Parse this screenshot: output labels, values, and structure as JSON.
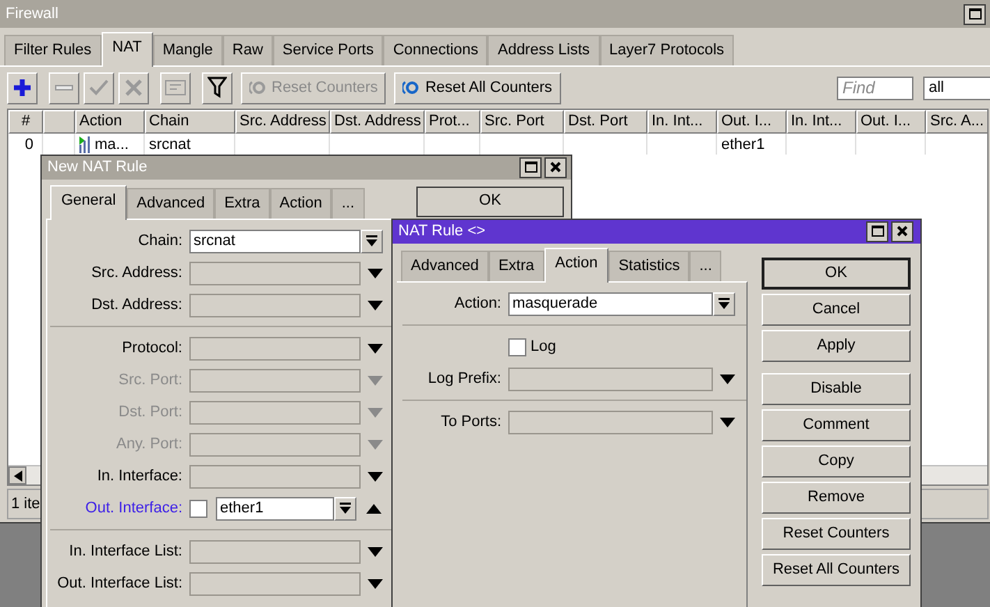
{
  "firewall": {
    "title": "Firewall",
    "tabs": [
      {
        "label": "Filter Rules",
        "selected": false
      },
      {
        "label": "NAT",
        "selected": true
      },
      {
        "label": "Mangle",
        "selected": false
      },
      {
        "label": "Raw",
        "selected": false
      },
      {
        "label": "Service Ports",
        "selected": false
      },
      {
        "label": "Connections",
        "selected": false
      },
      {
        "label": "Address Lists",
        "selected": false
      },
      {
        "label": "Layer7 Protocols",
        "selected": false
      }
    ],
    "toolbar": {
      "icon_buttons": [
        {
          "kind": "add",
          "disabled": false
        },
        {
          "kind": "remove",
          "disabled": true
        },
        {
          "kind": "enable",
          "disabled": true
        },
        {
          "kind": "disable",
          "disabled": true
        },
        {
          "kind": "comment",
          "disabled": true
        },
        {
          "kind": "filter",
          "disabled": false
        }
      ],
      "text_buttons": [
        {
          "label": "Reset Counters",
          "disabled": true
        },
        {
          "label": "Reset All Counters",
          "disabled": false
        }
      ],
      "find": {
        "placeholder": "Find"
      },
      "filter_select": {
        "value": "all"
      }
    },
    "table": {
      "columns": [
        "#",
        null,
        "Action",
        "Chain",
        "Src. Address",
        "Dst. Address",
        "Prot...",
        "Src. Port",
        "Dst. Port",
        "In. Int...",
        "Out. I...",
        "In. Int...",
        "Out. I...",
        "Src. A..."
      ],
      "rows": [
        {
          "cells": [
            "0",
            null,
            "ma...",
            "srcnat",
            null,
            null,
            null,
            null,
            null,
            null,
            "ether1",
            null,
            null,
            null
          ]
        }
      ]
    },
    "status": "1 ite"
  },
  "new_nat_rule": {
    "title": "New NAT Rule",
    "tabs": [
      {
        "label": "General",
        "selected": true
      },
      {
        "label": "Advanced",
        "selected": false
      },
      {
        "label": "Extra",
        "selected": false
      },
      {
        "label": "Action",
        "selected": false
      },
      {
        "label": "...",
        "selected": false
      }
    ],
    "ok_button": "OK",
    "groups": [
      [
        {
          "kind": "select",
          "label": "Chain:",
          "value": "srcnat"
        },
        {
          "kind": "combo",
          "label": "Src. Address:",
          "disabled": false
        },
        {
          "kind": "combo",
          "label": "Dst. Address:",
          "disabled": false
        }
      ],
      [
        {
          "kind": "combo",
          "label": "Protocol:",
          "disabled": false
        },
        {
          "kind": "combo",
          "label": "Src. Port:",
          "disabled": true
        },
        {
          "kind": "combo",
          "label": "Dst. Port:",
          "disabled": true
        },
        {
          "kind": "combo",
          "label": "Any. Port:",
          "disabled": true
        },
        {
          "kind": "combo",
          "label": "In. Interface:",
          "disabled": false
        },
        {
          "kind": "interface",
          "label": "Out. Interface:",
          "value": "ether1",
          "checked": false
        }
      ],
      [
        {
          "kind": "combo",
          "label": "In. Interface List:",
          "disabled": false
        },
        {
          "kind": "combo",
          "label": "Out. Interface List:",
          "disabled": false
        }
      ]
    ]
  },
  "nat_rule": {
    "title": "NAT Rule <>",
    "tabs": [
      {
        "label": "Advanced",
        "selected": false
      },
      {
        "label": "Extra",
        "selected": false
      },
      {
        "label": "Action",
        "selected": true
      },
      {
        "label": "Statistics",
        "selected": false
      },
      {
        "label": "...",
        "selected": false
      }
    ],
    "groups": [
      [
        {
          "kind": "select",
          "label": "Action:",
          "value": "masquerade"
        }
      ],
      [
        {
          "kind": "checkbox",
          "label": "Log",
          "checked": false
        },
        {
          "kind": "combo",
          "label": "Log Prefix:",
          "disabled": false
        }
      ],
      [
        {
          "kind": "combo",
          "label": "To Ports:",
          "disabled": false
        }
      ]
    ],
    "buttons": [
      {
        "label": "OK",
        "focused": true
      },
      {
        "label": "Cancel",
        "focused": false
      },
      {
        "label": "Apply",
        "focused": false
      },
      {
        "label": "Disable",
        "focused": false
      },
      {
        "label": "Comment",
        "focused": false
      },
      {
        "label": "Copy",
        "focused": false
      },
      {
        "label": "Remove",
        "focused": false
      },
      {
        "label": "Reset Counters",
        "focused": false
      },
      {
        "label": "Reset All Counters",
        "focused": false
      }
    ]
  }
}
